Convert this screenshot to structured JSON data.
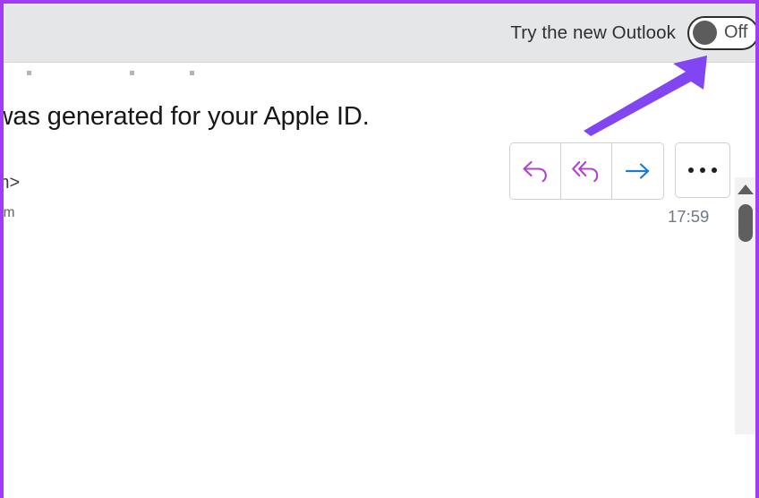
{
  "window": {
    "accent_border_color": "#a03cf5",
    "header_background": "#e4e6e8",
    "page_background": "#ffffff"
  },
  "header": {
    "try_new_outlook_label": "Try the new Outlook",
    "toggle": {
      "name": "try-new-outlook-toggle",
      "state_label": "Off",
      "state": "off",
      "knob_color": "#5c5c5c"
    }
  },
  "message": {
    "dots": [
      "dot",
      "dot",
      "dot"
    ],
    "subject_visible_text": "ord was generated for your Apple ID.",
    "sender_visible_text": "mail.apple.com>",
    "recipient_visible_text": "ook.com",
    "timestamp": "17:59"
  },
  "actions": {
    "reply": {
      "label": "Reply",
      "icon": "reply-icon",
      "color": "#b044c8"
    },
    "reply_all": {
      "label": "Reply all",
      "icon": "reply-all-icon",
      "color": "#b044c8"
    },
    "forward": {
      "label": "Forward",
      "icon": "forward-arrow-icon",
      "color": "#1a7ad4"
    },
    "more": {
      "label": "More actions",
      "icon": "ellipsis-icon",
      "color": "#1f1f1f"
    }
  },
  "scrollbar": {
    "up_arrow": "scroll-up-arrow",
    "thumb": "scroll-thumb",
    "track_color": "#f2f2f2",
    "thumb_color": "#5f5f5f"
  },
  "annotation": {
    "arrow": "pointer-arrow",
    "color": "#8245f2",
    "points_to": "try-new-outlook-toggle"
  }
}
